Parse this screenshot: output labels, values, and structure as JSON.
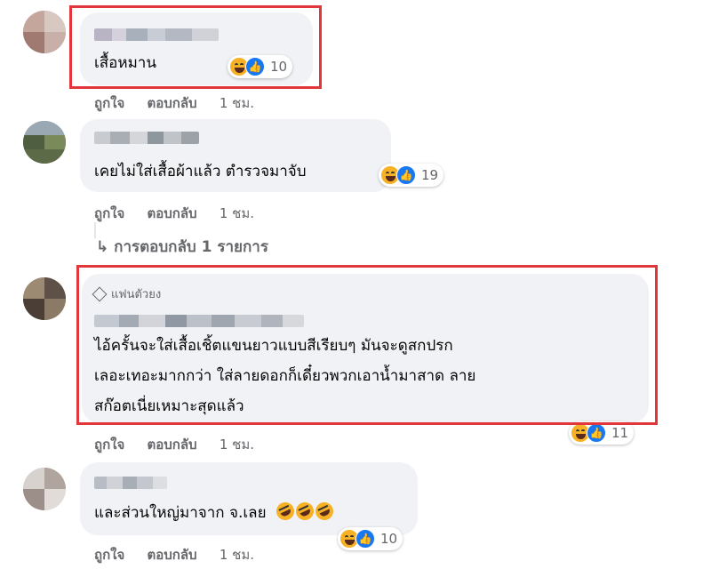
{
  "comments": [
    {
      "text_lines": [
        "เสื้อหมาน"
      ],
      "actions": {
        "like": "ถูกใจ",
        "reply": "ตอบกลับ",
        "time": "1 ชม."
      },
      "reactions": {
        "icons": [
          "haha-icon",
          "like-icon"
        ],
        "count": "10"
      },
      "highlighted": true
    },
    {
      "text_lines": [
        "เคยไม่ใส่เสื้อผ้าแล้ว ตำรวจมาจับ"
      ],
      "actions": {
        "like": "ถูกใจ",
        "reply": "ตอบกลับ",
        "time": "1 ชม."
      },
      "reactions": {
        "icons": [
          "haha-icon",
          "like-icon"
        ],
        "count": "19"
      },
      "replies_link": "↳ การตอบกลับ 1 รายการ",
      "highlighted": false
    },
    {
      "badge": "แฟนตัวยง",
      "text_lines": [
        "ไอ้ครั้นจะใส่เสื้อเชิ้ตแขนยาวแบบสีเรียบๆ มันจะดูสกปรก",
        "เลอะเทอะมากกว่า ใส่ลายดอกก็เดี๋ยวพวกเอาน้ำมาสาด ลาย",
        "สก๊อตเนี่ยเหมาะสุดแล้ว"
      ],
      "actions": {
        "like": "ถูกใจ",
        "reply": "ตอบกลับ",
        "time": "1 ชม."
      },
      "reactions": {
        "icons": [
          "haha-icon",
          "like-icon"
        ],
        "count": "11"
      },
      "highlighted": true
    },
    {
      "text_lines": [
        "และส่วนใหญ่มาจาก จ.เลย"
      ],
      "trailing_emoji": [
        "rofl-icon",
        "rofl-icon",
        "rofl-icon"
      ],
      "actions": {
        "like": "ถูกใจ",
        "reply": "ตอบกลับ",
        "time": "1 ชม."
      },
      "reactions": {
        "icons": [
          "haha-icon",
          "like-icon"
        ],
        "count": "10"
      },
      "highlighted": false
    }
  ],
  "colors": {
    "bubble": "#f0f2f5",
    "highlight": "#e0363c",
    "meta_text": "#65676b",
    "like_blue": "#1877f2",
    "haha_yellow": "#f7b125"
  }
}
